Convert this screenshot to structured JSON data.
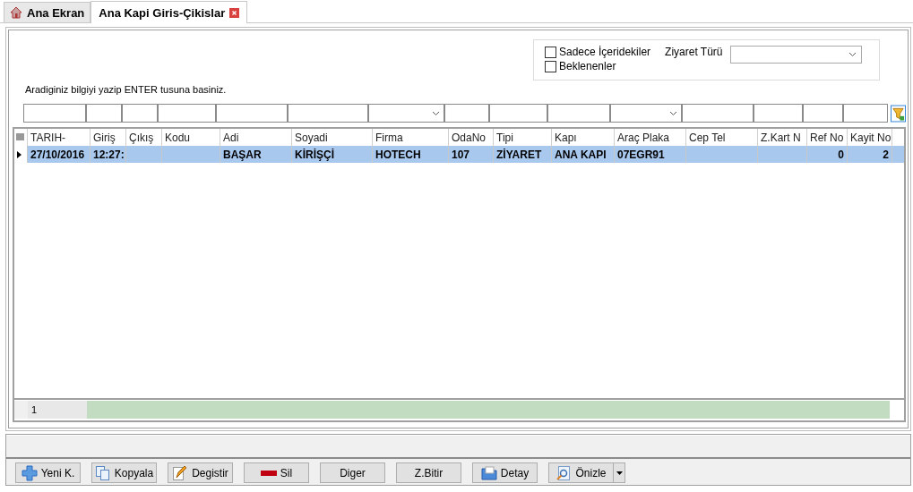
{
  "tabs": [
    {
      "label": "Ana Ekran",
      "selected": false,
      "closable": false
    },
    {
      "label": "Ana Kapi Giris-Çikislar",
      "selected": true,
      "closable": true
    }
  ],
  "filters": {
    "checkboxes": [
      {
        "label": "Sadece İçeridekiler",
        "checked": false
      },
      {
        "label": "Beklenenler",
        "checked": false
      }
    ],
    "visit_type": {
      "label": "Ziyaret Türü"
    },
    "hint": "Aradiginiz bilgiyi yazip ENTER tusuna basiniz."
  },
  "filter_row": [
    {
      "kind": "text"
    },
    {
      "kind": "text"
    },
    {
      "kind": "text"
    },
    {
      "kind": "text"
    },
    {
      "kind": "text"
    },
    {
      "kind": "text"
    },
    {
      "kind": "dropdown"
    },
    {
      "kind": "text"
    },
    {
      "kind": "text"
    },
    {
      "kind": "text"
    },
    {
      "kind": "dropdown"
    },
    {
      "kind": "text"
    },
    {
      "kind": "text"
    },
    {
      "kind": "text"
    },
    {
      "kind": "text"
    }
  ],
  "table": {
    "columns": [
      {
        "label": "TARIH-",
        "kind": "text"
      },
      {
        "label": "Giriş",
        "kind": "text"
      },
      {
        "label": "Çıkış",
        "kind": "text"
      },
      {
        "label": "Kodu",
        "kind": "text"
      },
      {
        "label": "Adi",
        "kind": "text"
      },
      {
        "label": "Soyadi",
        "kind": "text"
      },
      {
        "label": "Firma",
        "kind": "text"
      },
      {
        "label": "OdaNo",
        "kind": "text"
      },
      {
        "label": "Tipi",
        "kind": "text"
      },
      {
        "label": "Kapı",
        "kind": "text"
      },
      {
        "label": "Araç Plaka",
        "kind": "text"
      },
      {
        "label": "Cep Tel",
        "kind": "text"
      },
      {
        "label": "Z.Kart N",
        "kind": "text"
      },
      {
        "label": "Ref No",
        "kind": "number"
      },
      {
        "label": "Kayit No",
        "kind": "number"
      }
    ],
    "rows": [
      {
        "selected": true,
        "cells": [
          "27/10/2016",
          "12:27:",
          "",
          "",
          "BAŞAR",
          "KİRİŞÇİ",
          "HOTECH",
          "107",
          "ZİYARET",
          "ANA KAPI",
          "07EGR91",
          "",
          "",
          "0",
          "2"
        ]
      }
    ],
    "footer": {
      "count": "1"
    }
  },
  "buttons": [
    {
      "label": "Yeni K.",
      "menu": false
    },
    {
      "label": "Kopyala",
      "menu": false
    },
    {
      "label": "Degistir",
      "menu": false
    },
    {
      "label": "Sil",
      "menu": false
    },
    {
      "label": "Diger",
      "menu": false
    },
    {
      "label": "Z.Bitir",
      "menu": false
    },
    {
      "label": "Detay",
      "menu": false
    },
    {
      "label": "Önizle",
      "menu": true
    }
  ]
}
